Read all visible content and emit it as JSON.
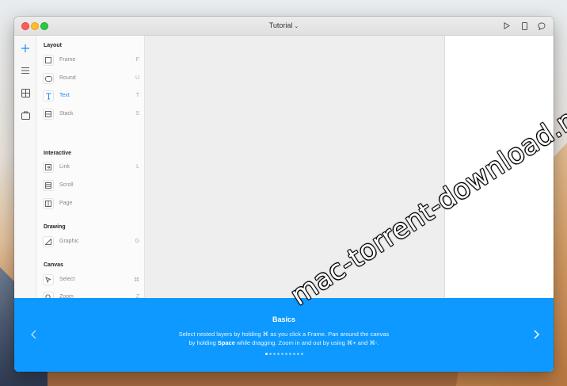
{
  "window": {
    "title": "Tutorial",
    "title_caret": "⌄"
  },
  "toolbar": {
    "icons": [
      "play-icon",
      "device-icon",
      "comment-icon"
    ]
  },
  "rail": {
    "icons": [
      "insert-plus-icon",
      "layers-icon",
      "components-icon",
      "store-icon"
    ],
    "accent": "#1a8cff"
  },
  "sections": {
    "layout": {
      "title": "Layout",
      "items": [
        {
          "label": "Frame",
          "key": "F"
        },
        {
          "label": "Round",
          "key": "U"
        },
        {
          "label": "Text",
          "key": "T"
        },
        {
          "label": "Stack",
          "key": "S"
        }
      ]
    },
    "interactive": {
      "title": "Interactive",
      "items": [
        {
          "label": "Link",
          "key": "L"
        },
        {
          "label": "Scroll",
          "key": ""
        },
        {
          "label": "Page",
          "key": ""
        }
      ]
    },
    "drawing": {
      "title": "Drawing",
      "items": [
        {
          "label": "Graphic",
          "key": "G"
        }
      ]
    },
    "canvas": {
      "title": "Canvas",
      "items": [
        {
          "label": "Select",
          "key": "⌘"
        },
        {
          "label": "Zoom",
          "key": "Z"
        }
      ]
    }
  },
  "banner": {
    "title": "Basics",
    "line1_a": "Select nested layers by holding ⌘ as you click a Frame. Pan around the canvas",
    "line2_a": "by holding ",
    "line2_b": "Space",
    "line2_c": " while dragging. Zoom in and out by using ⌘+ and ⌘-.",
    "page_count": 10,
    "current_page": 1,
    "background": "#0d99ff"
  },
  "watermark": "mac-torrent-download.net"
}
